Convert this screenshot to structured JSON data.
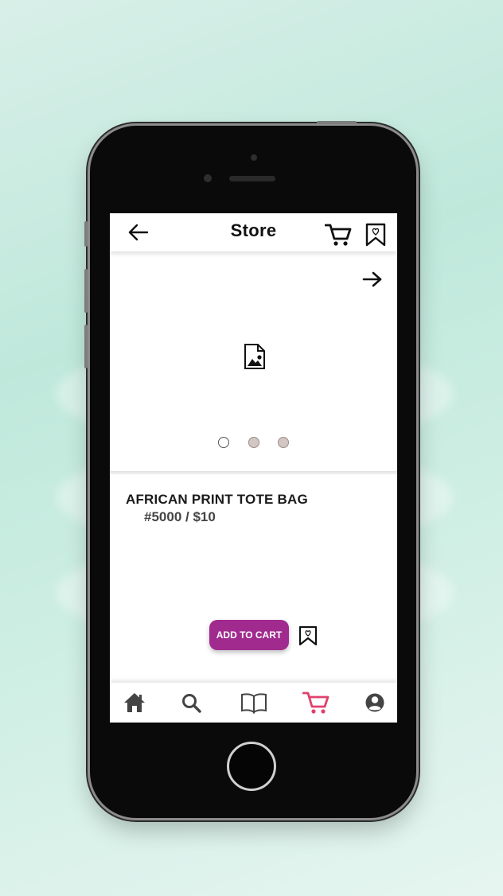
{
  "header": {
    "title": "Store",
    "back_icon": "arrow-left-icon",
    "cart_icon": "cart-icon",
    "bookmark_icon": "bookmark-heart-icon"
  },
  "carousel": {
    "next_icon": "arrow-right-icon",
    "placeholder_icon": "image-placeholder-icon",
    "page_count": 3,
    "active_index": 0
  },
  "product": {
    "name": "AFRICAN PRINT TOTE BAG",
    "price": "#5000 / $10"
  },
  "actions": {
    "add_to_cart_label": "ADD TO CART",
    "save_icon": "bookmark-heart-icon"
  },
  "bottom_nav": {
    "items": [
      {
        "icon": "home-icon"
      },
      {
        "icon": "search-icon"
      },
      {
        "icon": "book-icon"
      },
      {
        "icon": "cart-icon",
        "active": true
      },
      {
        "icon": "account-icon"
      }
    ]
  },
  "colors": {
    "accent": "#a12a8f",
    "active_nav": "#e0416e",
    "nav_icon": "#444444"
  }
}
